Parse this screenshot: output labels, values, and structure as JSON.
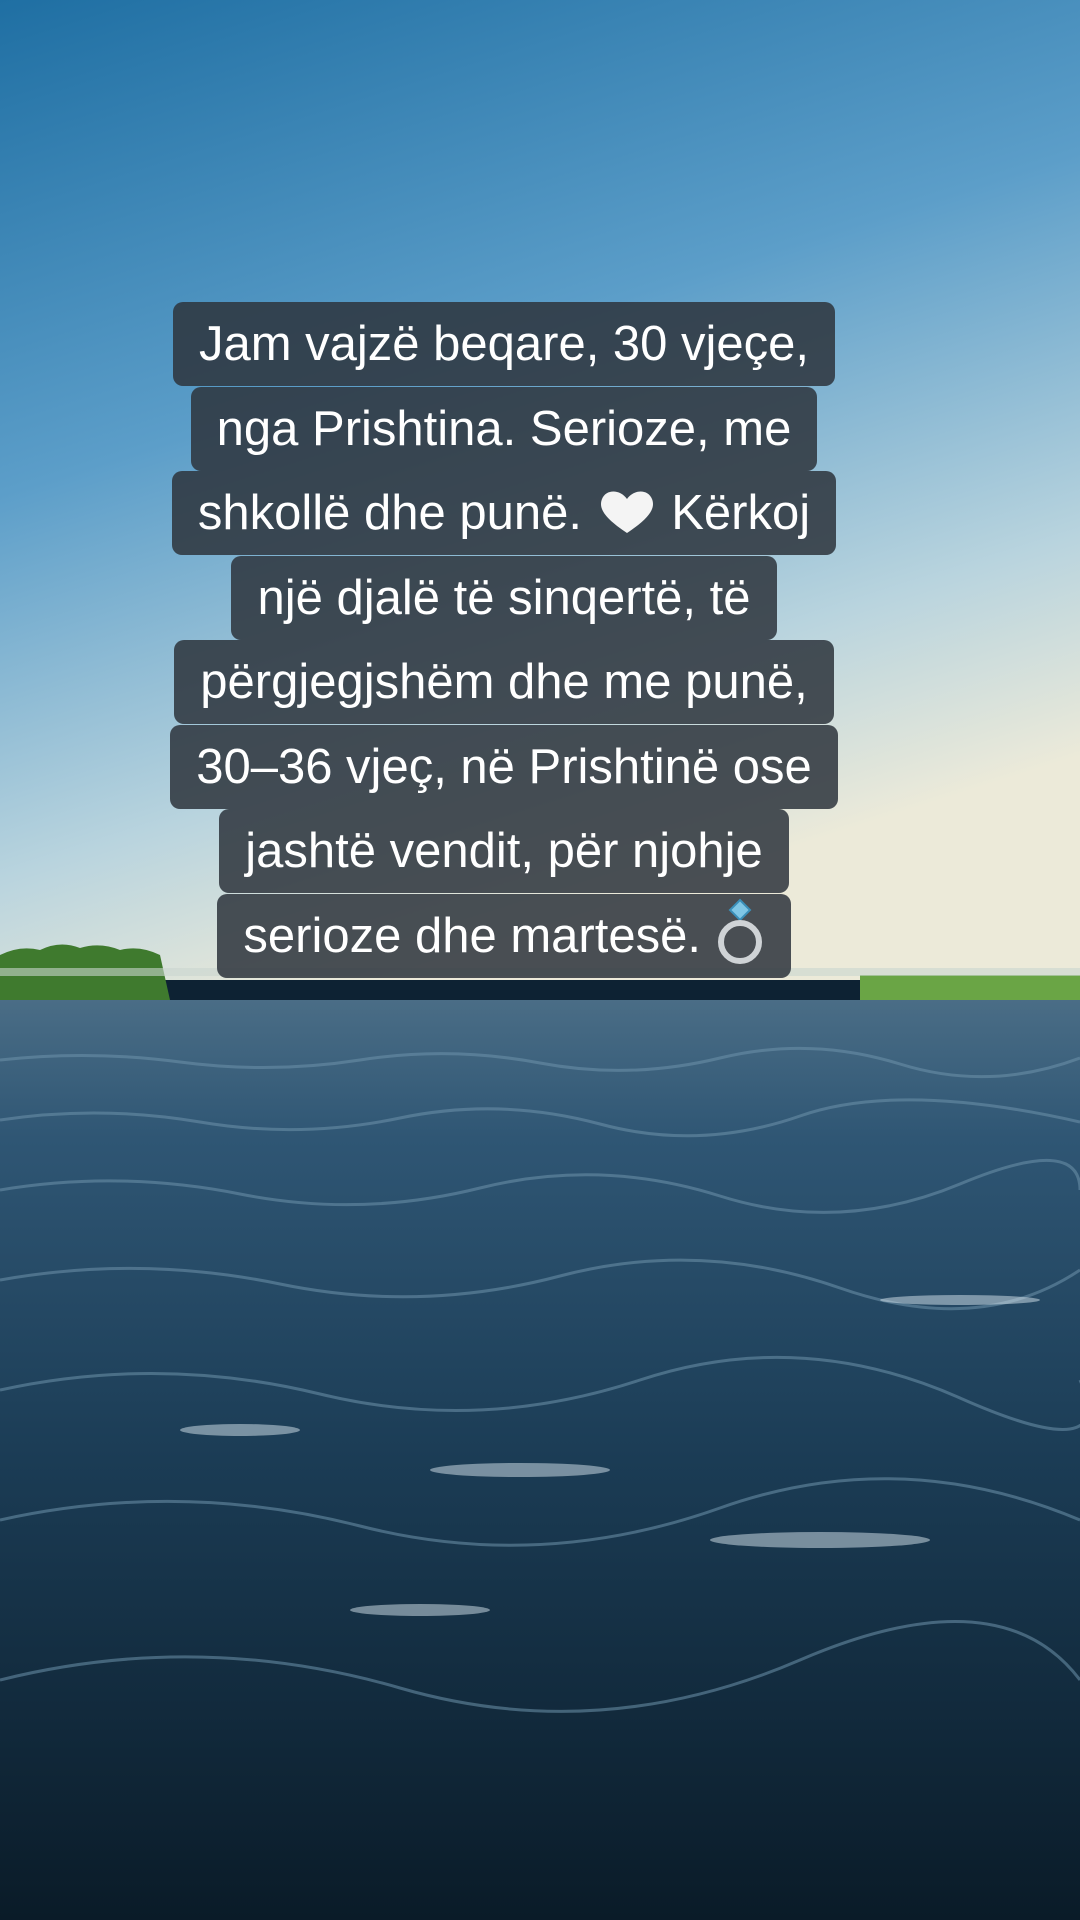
{
  "caption": {
    "lines": [
      "Jam vajzë beqare, 30 vjeçe,",
      "nga Prishtina. Serioze, me",
      "shkollë dhe punë.",
      "Kërkoj",
      "një djalë të sinqertë, të",
      "përgjegjshëm dhe me punë,",
      "30–36 vjeç, në Prishtinë ose",
      "jashtë vendit, për njohje",
      "serioze dhe martesë."
    ],
    "emojis": [
      "white-heart",
      "ring"
    ]
  },
  "scene": {
    "sky_top": "#1f6fa3",
    "sky_horizon": "#e6e6dc",
    "water": "#132f45",
    "shore": "#5c9a3c"
  }
}
